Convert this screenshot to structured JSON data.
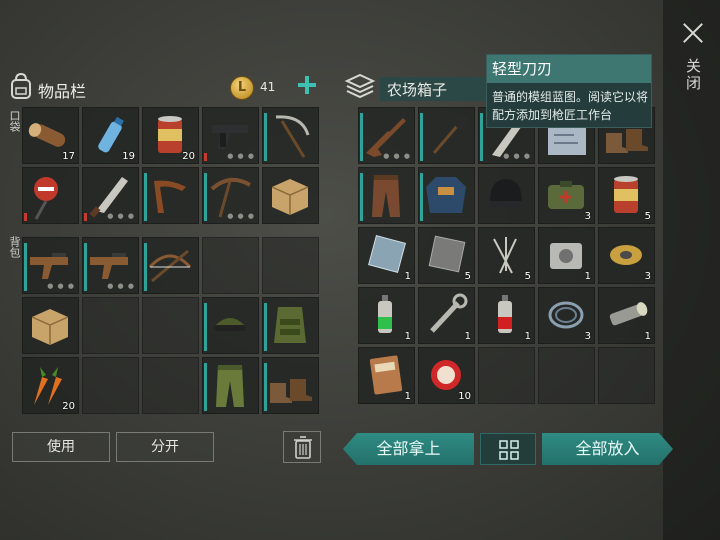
{
  "close": {
    "label": "关闭",
    "icon": "close-x-icon"
  },
  "inventory": {
    "title": "物品栏",
    "coins": "41",
    "pockets_label": "口袋",
    "backpack_label": "背包",
    "pockets": [
      {
        "icon": "log-icon",
        "count": "17"
      },
      {
        "icon": "water-bottle-icon",
        "count": "19"
      },
      {
        "icon": "canned-food-icon",
        "count": "20"
      },
      {
        "icon": "pistol-icon",
        "dots": true,
        "durability": "red"
      },
      {
        "icon": "scythe-icon",
        "durability": "teal"
      },
      {
        "icon": "stop-sign-icon",
        "durability": "red"
      },
      {
        "icon": "machete-icon",
        "dots": true,
        "durability": "red"
      },
      {
        "icon": "boomerang-icon",
        "durability": "teal"
      },
      {
        "icon": "pickaxe-icon",
        "dots": true,
        "durability": "teal"
      },
      {
        "icon": "cardboard-box-icon"
      }
    ],
    "backpack": [
      {
        "icon": "smg-icon",
        "dots": true,
        "durability": "teal"
      },
      {
        "icon": "smg-icon",
        "dots": true,
        "durability": "teal"
      },
      {
        "icon": "crossbow-icon",
        "durability": "teal"
      },
      {
        "icon": ""
      },
      {
        "icon": ""
      },
      {
        "icon": "cardboard-box-icon"
      },
      {
        "icon": ""
      },
      {
        "icon": ""
      },
      {
        "icon": "cap-with-goggles-icon",
        "durability": "teal"
      },
      {
        "icon": "tactical-vest-icon",
        "durability": "teal"
      },
      {
        "icon": "carrots-icon",
        "count": "20"
      },
      {
        "icon": ""
      },
      {
        "icon": ""
      },
      {
        "icon": "camo-pants-icon",
        "durability": "teal"
      },
      {
        "icon": "boots-icon",
        "durability": "teal"
      }
    ],
    "use_button": "使用",
    "split_button": "分开"
  },
  "box": {
    "title": "农场箱子",
    "items": [
      {
        "icon": "rifle-icon",
        "dots": true,
        "durability": "teal"
      },
      {
        "icon": "shovel-icon",
        "durability": "teal"
      },
      {
        "icon": "blade-icon",
        "dots": true,
        "durability": "teal"
      },
      {
        "icon": "blueprint-icon"
      },
      {
        "icon": "boots-icon"
      },
      {
        "icon": "leather-pants-icon",
        "durability": "teal"
      },
      {
        "icon": "padded-jacket-icon",
        "durability": "teal"
      },
      {
        "icon": "beanie-icon"
      },
      {
        "icon": "medkit-bag-icon",
        "count": "3"
      },
      {
        "icon": "canned-food-icon",
        "count": "5"
      },
      {
        "icon": "glass-sheet-icon",
        "count": "1"
      },
      {
        "icon": "metal-plate-icon",
        "count": "5"
      },
      {
        "icon": "nails-icon",
        "count": "5"
      },
      {
        "icon": "engine-part-icon",
        "count": "1"
      },
      {
        "icon": "wire-spool-icon",
        "count": "3"
      },
      {
        "icon": "green-spray-can-icon",
        "count": "1"
      },
      {
        "icon": "wrench-icon",
        "count": "1"
      },
      {
        "icon": "red-spray-can-icon",
        "count": "1"
      },
      {
        "icon": "wire-coil-icon",
        "count": "3"
      },
      {
        "icon": "flashlight-icon",
        "count": "1"
      },
      {
        "icon": "diary-book-icon",
        "count": "1"
      },
      {
        "icon": "bottle-cap-icon",
        "count": "10"
      },
      {
        "icon": ""
      },
      {
        "icon": ""
      },
      {
        "icon": ""
      }
    ],
    "take_all": "全部拿上",
    "put_all": "全部放入"
  },
  "tooltip": {
    "title": "轻型刀刃",
    "description": "普通的模组蓝图。阅读它以将配方添加到枪匠工作台"
  },
  "colors": {
    "accent": "#2f8b83",
    "tooltip_bg": "#243d3c",
    "durability_teal": "#2fa39a",
    "durability_red": "#c43a2e"
  }
}
